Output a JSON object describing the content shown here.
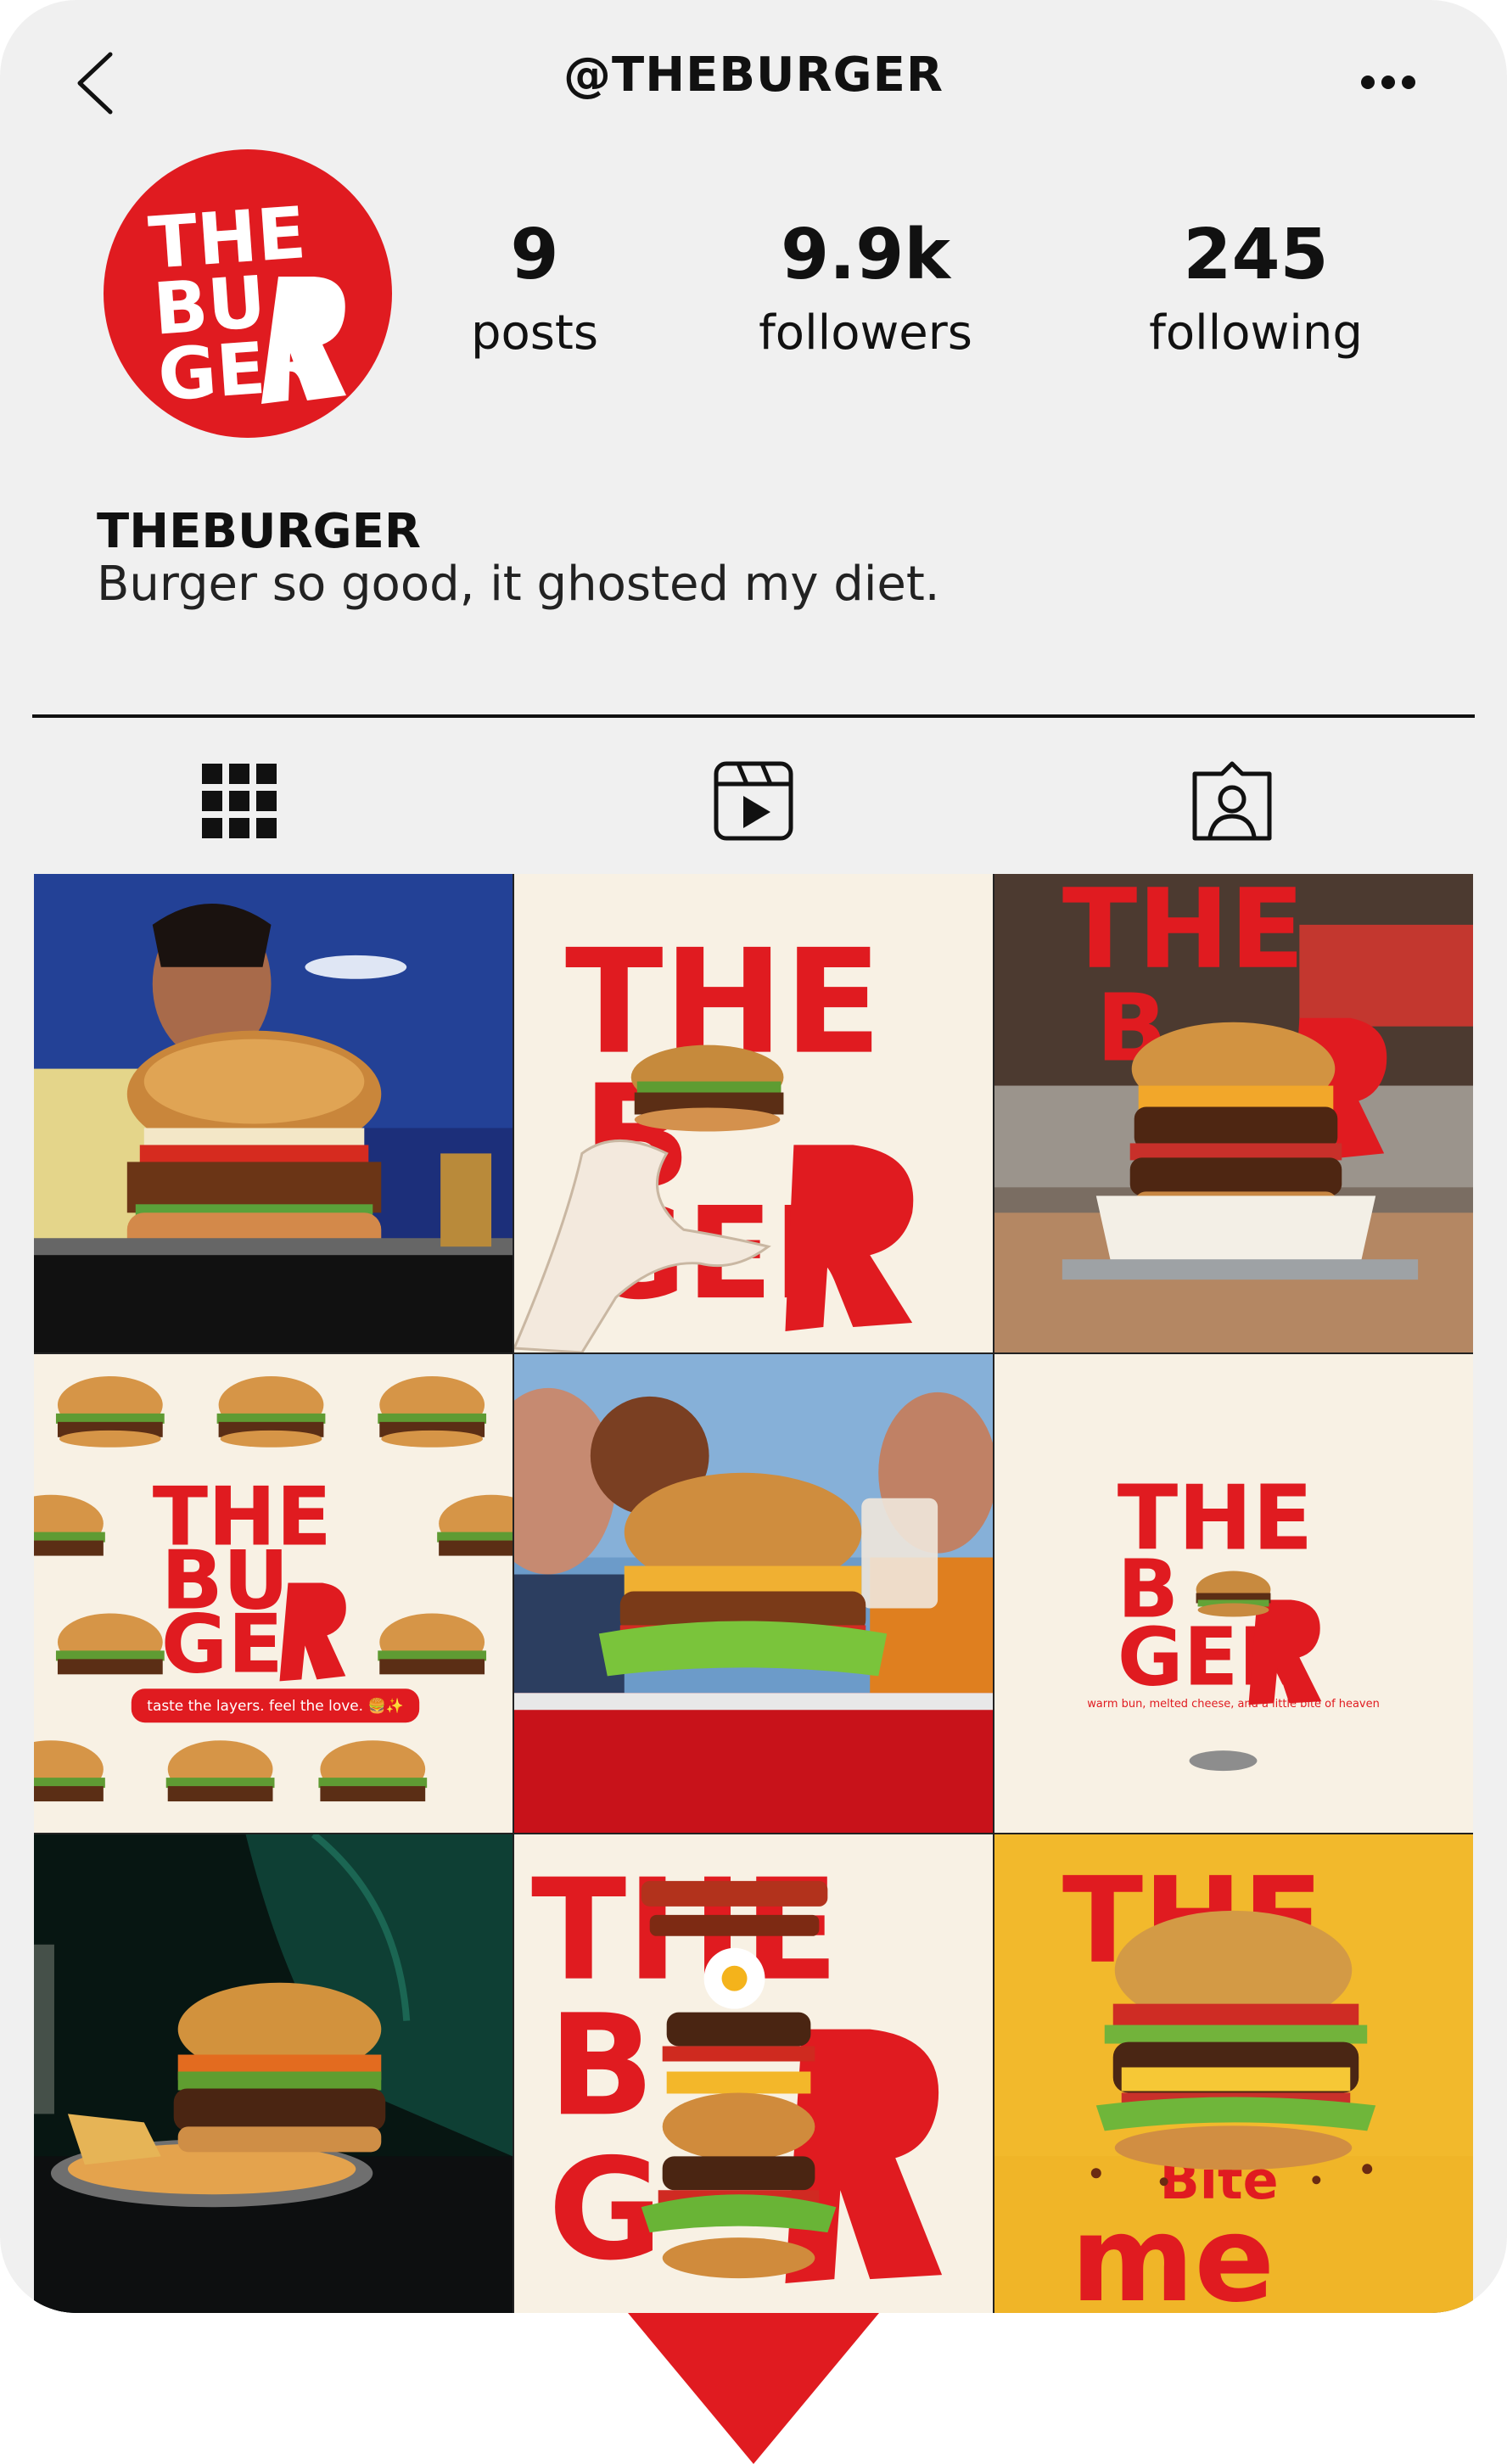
{
  "header": {
    "handle": "@THEBURGER",
    "back_icon": "chevron-left-icon",
    "more_icon": "more-dots-icon"
  },
  "profile": {
    "logo_text": [
      "THE",
      "BU",
      "GER"
    ],
    "stats": {
      "posts": {
        "value": "9",
        "label": "posts"
      },
      "followers": {
        "value": "9.9k",
        "label": "followers"
      },
      "following": {
        "value": "245",
        "label": "following"
      }
    },
    "name": "THEBURGER",
    "bio": "Burger so good, it ghosted my diet."
  },
  "tabs": [
    {
      "name": "posts-grid",
      "icon": "grid-icon",
      "active": true
    },
    {
      "name": "reels",
      "icon": "reels-icon",
      "active": false
    },
    {
      "name": "tagged",
      "icon": "tagged-person-icon",
      "active": false
    }
  ],
  "posts": {
    "p2_wordmark": [
      "THE",
      "B",
      "GER"
    ],
    "p4_tagline": "taste the layers. feel the love. 🍔✨",
    "p6_wordmark": [
      "THE",
      "B",
      "GER"
    ],
    "p6_caption": "warm bun, melted cheese, and a little bite of heaven",
    "p9_text": [
      "THE",
      "Bite",
      "me"
    ]
  },
  "colors": {
    "brand_red": "#e01b20",
    "cream": "#f8f1e4",
    "background": "#f0f0f0",
    "mustard": "#f2b92c"
  }
}
